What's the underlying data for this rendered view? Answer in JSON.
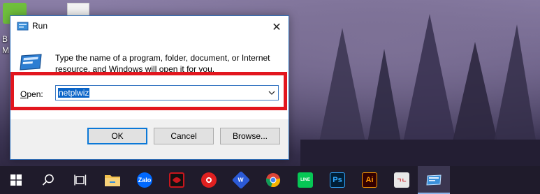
{
  "desktop": {
    "icon_caption": "B\nM"
  },
  "dialog": {
    "title": "Run",
    "description": "Type the name of a program, folder, document, or Internet resource, and Windows will open it for you.",
    "open_label_accel": "O",
    "open_label_rest": "pen:",
    "input_value": "netplwiz",
    "buttons": {
      "ok": "OK",
      "cancel": "Cancel",
      "browse": "Browse..."
    }
  },
  "taskbar": {
    "items": [
      {
        "name": "start-button",
        "icon": "windows-logo-icon"
      },
      {
        "name": "search-button",
        "icon": "search-icon"
      },
      {
        "name": "task-view-button",
        "icon": "task-view-icon"
      },
      {
        "name": "file-explorer",
        "icon": "folder-icon",
        "color": "#f2c14e"
      },
      {
        "name": "zalo",
        "icon": "zalo-icon",
        "label": "Zalo",
        "color": "#0068ff"
      },
      {
        "name": "garena",
        "icon": "garena-icon",
        "color": "#c8161d"
      },
      {
        "name": "screen-recorder",
        "icon": "record-icon",
        "color": "#e02020"
      },
      {
        "name": "wps-office",
        "icon": "wps-icon",
        "label": "W",
        "color": "#2b5ad6"
      },
      {
        "name": "chrome",
        "icon": "chrome-icon"
      },
      {
        "name": "line",
        "icon": "line-icon",
        "label": "LINE",
        "color": "#06c755"
      },
      {
        "name": "photoshop",
        "icon": "photoshop-icon",
        "label": "Ps",
        "color": "#001e36"
      },
      {
        "name": "illustrator",
        "icon": "illustrator-icon",
        "label": "Ai",
        "color": "#330000"
      },
      {
        "name": "keyboard-app",
        "icon": "keyboard-icon",
        "label": "ㄱㄴ",
        "color": "#e8e8e8"
      },
      {
        "name": "run",
        "icon": "run-icon",
        "active": true
      }
    ]
  }
}
